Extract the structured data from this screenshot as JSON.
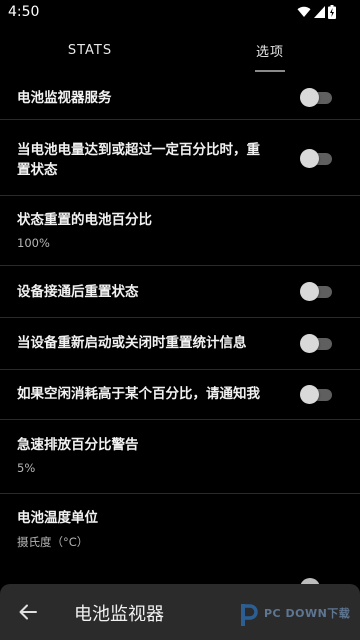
{
  "status_bar": {
    "time": "4:50",
    "icons": [
      "wifi-icon",
      "signal-icon",
      "battery-charging-icon"
    ]
  },
  "tabs": [
    {
      "label": "STATS",
      "selected": false
    },
    {
      "label": "选项",
      "selected": true
    }
  ],
  "settings": [
    {
      "title": "电池监视器服务",
      "has_toggle": true,
      "checked": false
    },
    {
      "title_line1": "当电池电量达到或超过一定百分比时，重",
      "title_line2": "置状态",
      "has_toggle": true,
      "checked": false
    },
    {
      "title": "状态重置的电池百分比",
      "value": "100%"
    },
    {
      "title": "设备接通后重置状态",
      "has_toggle": true,
      "checked": false
    },
    {
      "title": "当设备重新启动或关闭时重置统计信息",
      "has_toggle": true,
      "checked": false
    },
    {
      "title": "如果空闲消耗高于某个百分比，请通知我",
      "has_toggle": true,
      "checked": false
    },
    {
      "title": "急速排放百分比警告",
      "value": "5%"
    },
    {
      "title": "电池温度单位",
      "value": "摄氏度（°C）"
    }
  ],
  "bottom_bar": {
    "title": "电池监视器",
    "back_icon": "arrow-left-icon"
  },
  "watermark": {
    "text": "PC DOWN下载"
  },
  "colors": {
    "background": "#000000",
    "bottom_bar": "#2b2b2b",
    "toggle_track": "#5f5f5f",
    "toggle_thumb": "#d9d9d9"
  }
}
